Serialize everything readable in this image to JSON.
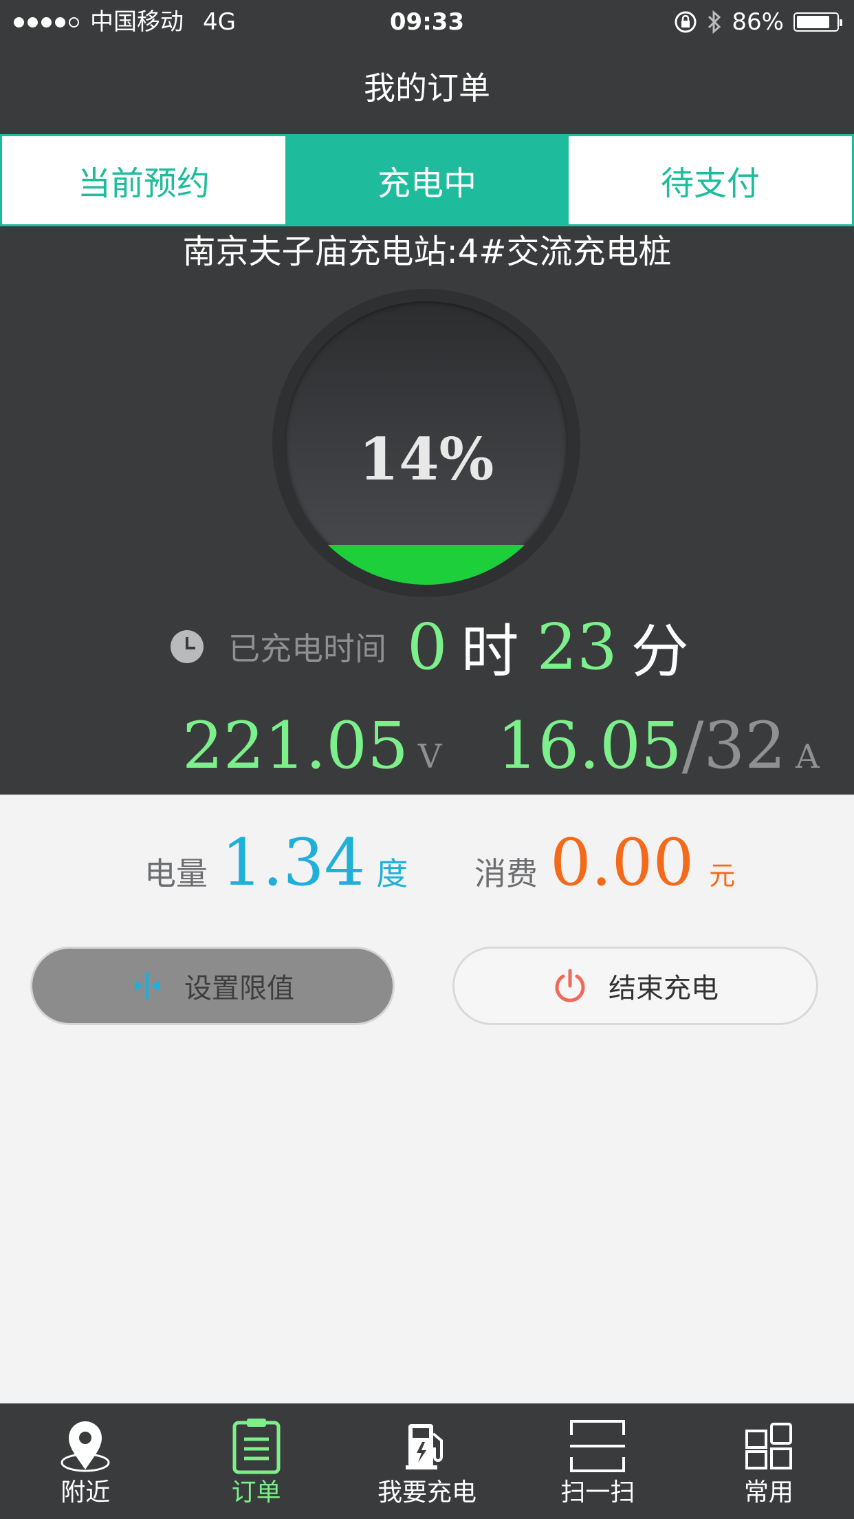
{
  "status_bar": {
    "carrier": "中国移动",
    "network": "4G",
    "time": "09:33",
    "battery": "86%",
    "battery_level": 0.86
  },
  "header": {
    "title": "我的订单"
  },
  "tabs": [
    {
      "label": "当前预约",
      "active": false
    },
    {
      "label": "充电中",
      "active": true
    },
    {
      "label": "待支付",
      "active": false
    }
  ],
  "charging": {
    "station": "南京夫子庙充电站:4#交流充电桩",
    "percent_text": "14%",
    "percent": 0.14,
    "time_label": "已充电时间",
    "hours": "0",
    "hours_unit": "时",
    "minutes": "23",
    "minutes_unit": "分",
    "voltage": "221.05",
    "voltage_unit": "V",
    "current": "16.05",
    "current_max": "/32",
    "current_unit": "A"
  },
  "summary": {
    "energy_label": "电量",
    "energy_value": "1.34",
    "energy_unit": "度",
    "cost_label": "消费",
    "cost_value": "0.00",
    "cost_unit": "元"
  },
  "actions": {
    "set_limit": "设置限值",
    "end_charging": "结束充电"
  },
  "tabbar": [
    {
      "label": "附近",
      "icon": "location-pin-icon",
      "active": false
    },
    {
      "label": "订单",
      "icon": "clipboard-icon",
      "active": true
    },
    {
      "label": "我要充电",
      "icon": "charging-station-icon",
      "active": false
    },
    {
      "label": "扫一扫",
      "icon": "scan-icon",
      "active": false
    },
    {
      "label": "常用",
      "icon": "grid-icon",
      "active": false
    }
  ],
  "colors": {
    "accent": "#1ebc9c",
    "dark": "#3a3b3d",
    "green": "#7cf08a",
    "blue": "#1fb0da",
    "orange": "#f36a1a"
  }
}
